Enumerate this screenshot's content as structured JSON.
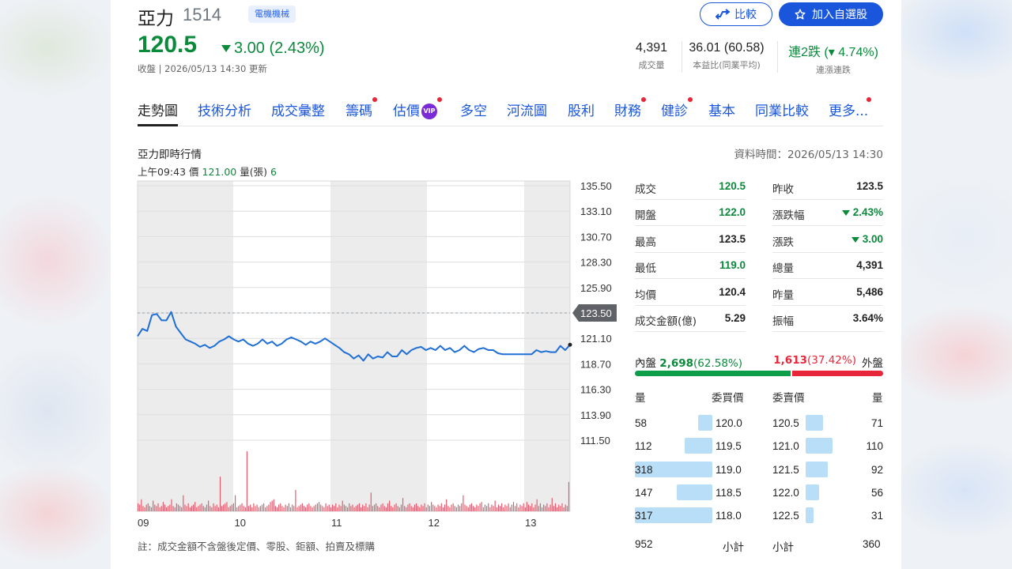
{
  "header": {
    "name": "亞力",
    "code": "1514",
    "industry": "電機機械",
    "compare_label": "比較",
    "watchlist_label": "加入自選股",
    "price": "120.5",
    "change": "3.00 (2.43%)",
    "close_note": "收盤 | 2026/05/13 14:30 更新",
    "stats": [
      {
        "value": "4,391",
        "label": "成交量"
      },
      {
        "value": "36.01 (60.58)",
        "label": "本益比(同業平均)"
      },
      {
        "value": "連2跌 (▾ 4.74%)",
        "label": "連漲連跌"
      }
    ]
  },
  "tabs": [
    {
      "label": "走勢圖",
      "dot": false
    },
    {
      "label": "技術分析",
      "dot": false
    },
    {
      "label": "成交彙整",
      "dot": false
    },
    {
      "label": "籌碼",
      "dot": true
    },
    {
      "label": "估價",
      "dot": true,
      "vip": "VIP"
    },
    {
      "label": "多空",
      "dot": false
    },
    {
      "label": "河流圖",
      "dot": false
    },
    {
      "label": "股利",
      "dot": false
    },
    {
      "label": "財務",
      "dot": true
    },
    {
      "label": "健診",
      "dot": true
    },
    {
      "label": "基本",
      "dot": false
    },
    {
      "label": "同業比較",
      "dot": false
    },
    {
      "label": "更多...",
      "dot": true
    }
  ],
  "section": {
    "title": "亞力即時行情",
    "data_time": "資料時間：2026/05/13 14:30",
    "hover": {
      "time": "上午09:43",
      "price_label": "價",
      "price": "121.00",
      "vol_label": "量(張)",
      "vol": "6"
    },
    "footnote": "註：成交金額不含盤後定價、零股、鉅額、拍賣及標購"
  },
  "chart_data": {
    "type": "line",
    "x_ticks": [
      "09",
      "10",
      "11",
      "12",
      "13"
    ],
    "y_ticks": [
      "135.50",
      "133.10",
      "130.70",
      "128.30",
      "125.90",
      "123.50",
      "121.10",
      "118.70",
      "116.30",
      "113.90",
      "111.50"
    ],
    "ylim": [
      111.5,
      135.5
    ],
    "prev_close": 123.5,
    "prev_close_label": "123.50",
    "series": [
      {
        "values": [
          121.3,
          122.0,
          121.8,
          123.3,
          123.4,
          122.8,
          122.8,
          123.6,
          122.2,
          121.6,
          121.0,
          120.8,
          120.6,
          120.3,
          120.5,
          120.2,
          120.4,
          120.8,
          121.0,
          121.3,
          121.0,
          120.8,
          121.0,
          120.6,
          120.4,
          120.6,
          121.0,
          120.6,
          120.8,
          120.4,
          120.6,
          121.0,
          121.2,
          121.0,
          120.8,
          120.5,
          120.8,
          120.6,
          120.8,
          121.1,
          120.8,
          120.5,
          120.2,
          119.8,
          119.6,
          119.2,
          119.5,
          119.0,
          119.6,
          119.2,
          119.4,
          119.3,
          119.8,
          119.4,
          119.4,
          120.0,
          119.6,
          120.0,
          120.2,
          120.3,
          120.0,
          120.2,
          120.0,
          120.4,
          120.0,
          120.2,
          119.8,
          120.0,
          120.4,
          120.0,
          119.8,
          120.1,
          120.2,
          120.0,
          120.0,
          119.7,
          119.6,
          119.6,
          119.6,
          119.6,
          119.6,
          119.6,
          119.6,
          120.0,
          119.8,
          119.9,
          119.8,
          119.8,
          120.4,
          120.0,
          120.5
        ]
      }
    ],
    "volume": [
      6,
      5,
      9,
      4,
      3,
      5,
      6,
      4,
      3,
      8,
      5,
      4,
      6,
      3,
      4,
      7,
      5,
      3,
      4,
      5,
      9,
      4,
      3,
      6,
      5,
      4,
      3,
      12,
      5,
      4,
      6,
      3,
      4,
      5,
      7,
      3,
      4,
      5,
      6,
      4,
      3,
      5,
      8,
      4,
      3,
      6,
      4,
      5,
      3,
      26,
      4,
      5,
      6,
      7,
      3,
      4,
      5,
      6,
      12,
      3,
      4,
      5,
      6,
      4,
      3,
      45,
      4,
      5,
      3,
      6,
      4,
      5,
      3,
      4,
      5,
      6,
      3,
      4,
      5,
      7,
      8,
      9,
      4,
      3,
      5,
      6,
      4,
      3,
      5,
      4,
      6,
      3,
      5,
      4,
      16,
      3,
      4,
      5,
      6,
      4,
      3,
      5,
      6,
      4,
      3,
      4,
      5,
      6,
      7,
      5,
      4,
      3,
      6,
      4,
      5,
      3,
      5,
      4,
      6,
      3,
      5,
      4,
      8,
      5,
      4,
      3,
      6,
      4,
      5,
      3,
      4,
      5,
      6,
      3,
      5,
      4,
      6,
      3,
      5,
      14,
      4,
      5,
      6,
      4,
      3,
      5,
      6,
      4,
      3,
      6,
      8,
      4,
      3,
      5,
      6,
      4,
      3,
      5,
      10,
      4,
      3,
      5,
      6,
      4,
      3,
      5,
      6,
      4,
      3,
      5,
      4,
      6,
      3,
      5,
      4,
      7,
      5,
      4,
      3,
      5,
      4,
      6,
      3,
      5,
      9,
      4,
      3,
      5,
      6,
      4,
      3,
      5,
      4,
      6,
      12,
      5,
      4,
      3,
      5,
      6,
      4,
      3,
      5,
      4,
      6,
      7,
      3,
      5,
      4,
      6,
      3,
      5,
      4,
      8,
      3,
      5,
      4,
      6,
      3,
      5,
      4,
      6,
      3,
      5,
      7,
      4,
      6,
      3,
      5,
      4,
      6,
      3,
      7,
      5,
      4,
      6,
      3,
      5,
      9,
      4,
      6,
      3,
      5,
      4,
      6,
      3,
      5,
      10,
      4,
      6,
      3,
      5,
      4,
      6,
      3,
      5,
      4,
      22
    ]
  },
  "quote": {
    "left": [
      {
        "k": "成交",
        "v": "120.5",
        "c": "green"
      },
      {
        "k": "開盤",
        "v": "122.0",
        "c": "green"
      },
      {
        "k": "最高",
        "v": "123.5",
        "c": "dark"
      },
      {
        "k": "最低",
        "v": "119.0",
        "c": "green"
      },
      {
        "k": "均價",
        "v": "120.4",
        "c": "dark"
      },
      {
        "k": "成交金額(億)",
        "v": "5.29",
        "c": "dark"
      }
    ],
    "right": [
      {
        "k": "昨收",
        "v": "123.5",
        "c": "dark"
      },
      {
        "k": "漲跌幅",
        "v": "2.43%",
        "c": "green",
        "arrow": true
      },
      {
        "k": "漲跌",
        "v": "3.00",
        "c": "green",
        "arrow": true
      },
      {
        "k": "總量",
        "v": "4,391",
        "c": "dark"
      },
      {
        "k": "昨量",
        "v": "5,486",
        "c": "dark"
      },
      {
        "k": "振幅",
        "v": "3.64%",
        "c": "dark"
      }
    ]
  },
  "inout": {
    "inner_label": "內盤",
    "inner_value": "2,698",
    "inner_pct": "(62.58%)",
    "outer_value": "1,613",
    "outer_pct": "(37.42%)",
    "outer_label": "外盤",
    "inner_ratio": 62.58
  },
  "orderbook": {
    "head": {
      "vol": "量",
      "bid": "委買價",
      "ask": "委賣價",
      "vol2": "量"
    },
    "bids": [
      {
        "vol": "58",
        "price": "120.0",
        "qty": 58
      },
      {
        "vol": "112",
        "price": "119.5",
        "qty": 112
      },
      {
        "vol": "318",
        "price": "119.0",
        "qty": 318
      },
      {
        "vol": "147",
        "price": "118.5",
        "qty": 147
      },
      {
        "vol": "317",
        "price": "118.0",
        "qty": 317
      }
    ],
    "asks": [
      {
        "price": "120.5",
        "vol": "71",
        "qty": 71
      },
      {
        "price": "121.0",
        "vol": "110",
        "qty": 110
      },
      {
        "price": "121.5",
        "vol": "92",
        "qty": 92
      },
      {
        "price": "122.0",
        "vol": "56",
        "qty": 56
      },
      {
        "price": "122.5",
        "vol": "31",
        "qty": 31
      }
    ],
    "bid_total": "952",
    "bid_total_label": "小計",
    "ask_total_label": "小計",
    "ask_total": "360"
  },
  "colors": {
    "up": "#e8263a",
    "down": "#0b8a3c",
    "brand": "#1a56db",
    "line": "#1f6fd6"
  }
}
